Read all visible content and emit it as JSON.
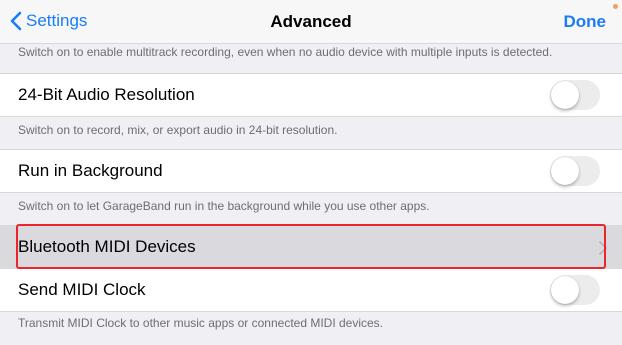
{
  "navbar": {
    "back_label": "Settings",
    "title": "Advanced",
    "done_label": "Done"
  },
  "footnotes": {
    "multitrack": "Switch on to enable multitrack recording, even when no audio device with multiple inputs is detected.",
    "audio_resolution": "Switch on to record, mix, or export audio in 24-bit resolution.",
    "background": "Switch on to let GarageBand run in the background while you use other apps.",
    "midi_clock": "Transmit MIDI Clock to other music apps or connected MIDI devices."
  },
  "rows": {
    "audio_resolution": {
      "label": "24-Bit Audio Resolution",
      "on": false
    },
    "background": {
      "label": "Run in Background",
      "on": false
    },
    "bluetooth_midi": {
      "label": "Bluetooth MIDI Devices"
    },
    "midi_clock": {
      "label": "Send MIDI Clock",
      "on": false
    }
  },
  "colors": {
    "accent": "#1a7cf7",
    "highlight_border": "#e8262b"
  }
}
